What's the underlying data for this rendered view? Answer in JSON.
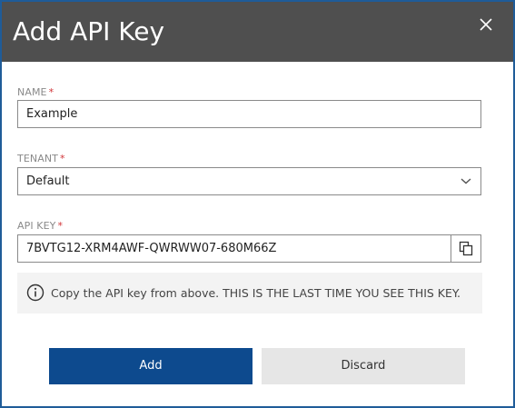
{
  "dialog": {
    "title": "Add API Key",
    "close_icon": "close-icon"
  },
  "form": {
    "name": {
      "label": "NAME",
      "required_mark": "*",
      "value": "Example"
    },
    "tenant": {
      "label": "TENANT",
      "required_mark": "*",
      "value": "Default",
      "icon": "chevron-down-icon"
    },
    "api_key": {
      "label": "API KEY",
      "required_mark": "*",
      "value": "7BVTG12-XRM4AWF-QWRWW07-680M66Z",
      "copy_icon": "copy-icon"
    }
  },
  "notice": {
    "icon": "info-icon",
    "text": "Copy the API key from above. THIS IS THE LAST TIME YOU SEE THIS KEY."
  },
  "buttons": {
    "add_label": "Add",
    "discard_label": "Discard"
  },
  "colors": {
    "header_bg": "#4f4f4f",
    "dialog_border": "#1f5c99",
    "primary": "#0d4a8e",
    "secondary": "#e6e6e6",
    "required": "#d13438"
  }
}
